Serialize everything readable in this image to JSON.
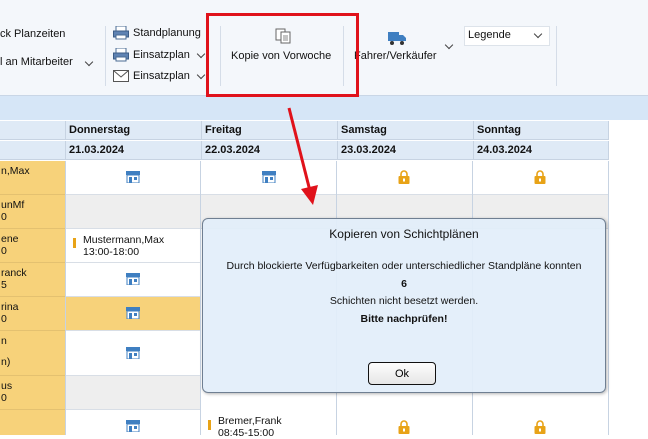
{
  "ribbon": {
    "planzeiten": "ck Planzeiten",
    "an_mitarbeiter": "l an Mitarbeiter",
    "standplanung": "Standplanung",
    "einsatzplan_1": "Einsatzplan",
    "einsatzplan_2": "Einsatzplan",
    "kopie_von_vorwoche": "Kopie von Vorwoche",
    "fahrer_verkaeufer": "Fahrer/Verkäufer",
    "legende": "Legende"
  },
  "days": [
    {
      "name": "Donnerstag",
      "date": "21.03.2024"
    },
    {
      "name": "Freitag",
      "date": "22.03.2024"
    },
    {
      "name": "Samstag",
      "date": "23.03.2024"
    },
    {
      "name": "Sonntag",
      "date": "24.03.2024"
    }
  ],
  "names": [
    {
      "l1": "n,Max",
      "l2": ""
    },
    {
      "l1": "unMf",
      "l2": "0"
    },
    {
      "l1": "ene",
      "l2": "0"
    },
    {
      "l1": "ranck",
      "l2": "5"
    },
    {
      "l1": "rina",
      "l2": "0"
    },
    {
      "l1": "n",
      "l2": "n)"
    },
    {
      "l1": "us",
      "l2": "0"
    }
  ],
  "shifts": {
    "mustermann_name": "Mustermann,Max",
    "mustermann_time": "13:00-18:00",
    "bremer_name": "Bremer,Frank",
    "bremer_time": "08:45-15:00"
  },
  "dialog": {
    "title": "Kopieren von Schichtplänen",
    "line1": "Durch blockierte Verfügbarkeiten oder unterschiedlicher Standpläne konnten",
    "count": "6",
    "line2": "Schichten nicht besetzt werden.",
    "line3": "Bitte nachprüfen!",
    "ok": "Ok"
  },
  "colors": {
    "accent_red": "#e0121b",
    "cell_yellow": "#f7d27a",
    "icon_blue": "#3f7fc1",
    "lock_orange": "#e8a317"
  }
}
